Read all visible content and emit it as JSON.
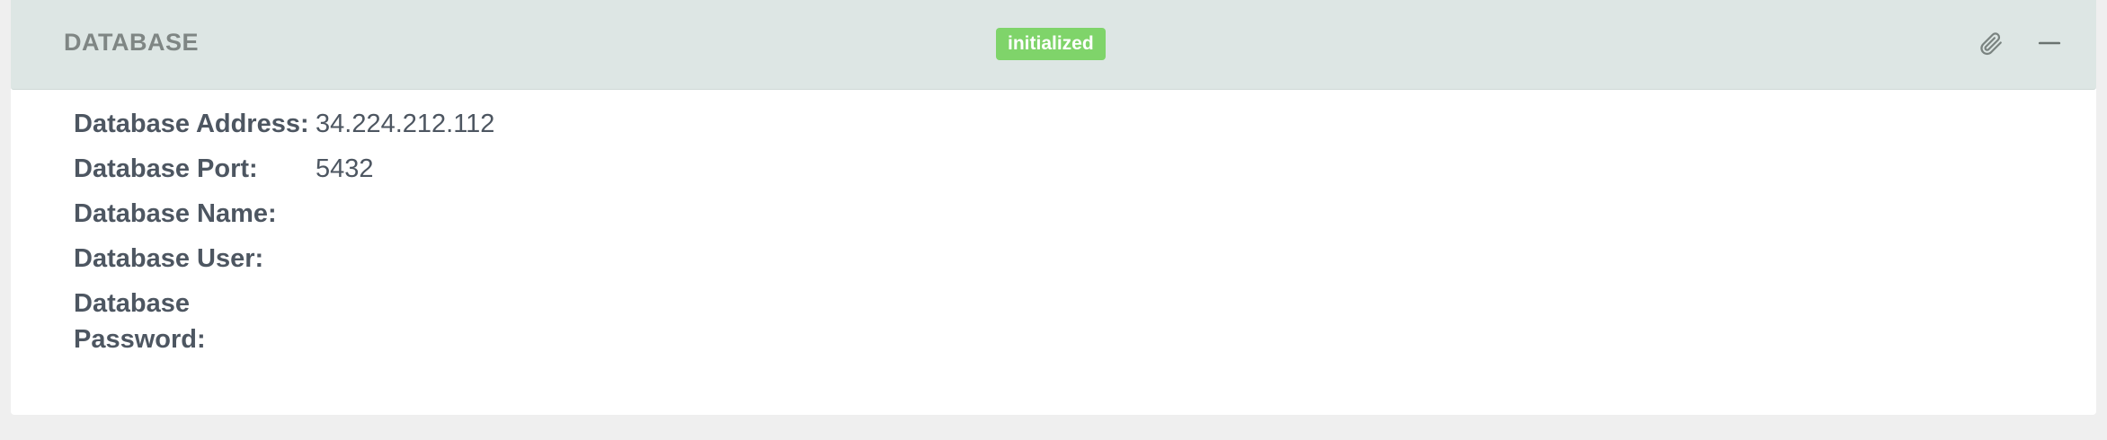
{
  "panel": {
    "title": "DATABASE",
    "status": "initialized",
    "colors": {
      "header_bg": "#dde6e4",
      "badge_bg": "#7fd46a",
      "label": "#4d5661",
      "title": "#7f8684"
    },
    "icons": {
      "edit": "paperclip-icon",
      "collapse": "minus-icon"
    }
  },
  "fields": [
    {
      "label": "Database Address:",
      "value": "34.224.212.112"
    },
    {
      "label": "Database Port:",
      "value": "5432"
    },
    {
      "label": "Database Name:",
      "value": ""
    },
    {
      "label": "Database User:",
      "value": ""
    },
    {
      "label": "Database Password:",
      "value": ""
    }
  ]
}
